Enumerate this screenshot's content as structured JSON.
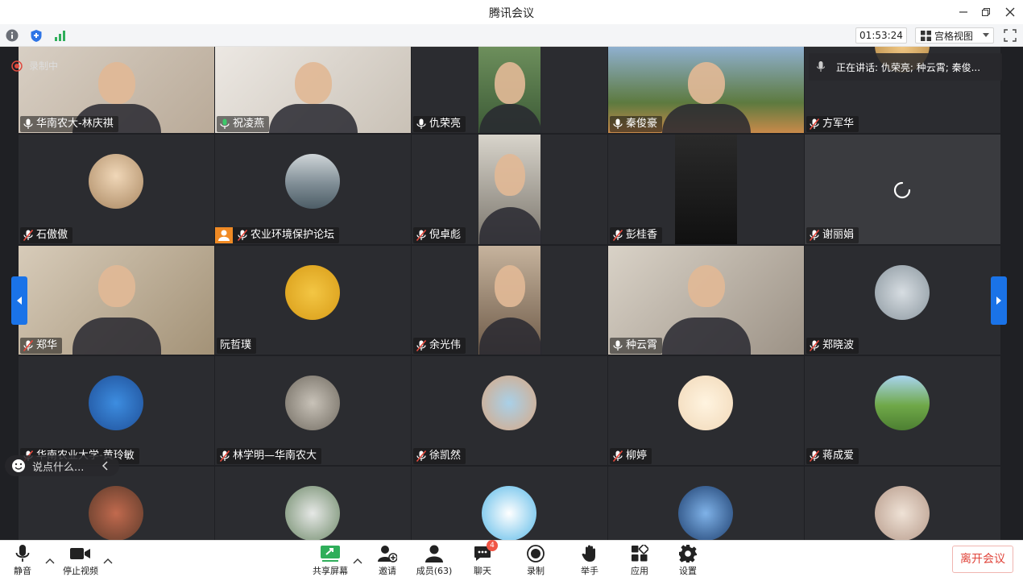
{
  "window": {
    "title": "腾讯会议"
  },
  "infobar": {
    "timer": "01:53:24",
    "view_mode": "宫格视图"
  },
  "stage": {
    "recording_label": "录制中",
    "speaking_label": "正在讲话: 仇荣亮; 种云霄; 秦俊...",
    "chat_placeholder": "说点什么..."
  },
  "participants": [
    {
      "name": "华南农大-林庆祺",
      "mic": "on"
    },
    {
      "name": "祝凌燕",
      "mic": "speaking"
    },
    {
      "name": "仇荣亮",
      "mic": "on"
    },
    {
      "name": "秦俊豪",
      "mic": "on"
    },
    {
      "name": "方军华",
      "mic": "muted"
    },
    {
      "name": "石傲傲",
      "mic": "muted"
    },
    {
      "name": "农业环境保护论坛",
      "mic": "muted"
    },
    {
      "name": "倪卓彪",
      "mic": "muted"
    },
    {
      "name": "彭桂香",
      "mic": "muted"
    },
    {
      "name": "谢丽娟",
      "mic": "muted"
    },
    {
      "name": "郑华",
      "mic": "muted"
    },
    {
      "name": "阮哲璞",
      "mic": "none"
    },
    {
      "name": "余光伟",
      "mic": "muted"
    },
    {
      "name": "种云霄",
      "mic": "on"
    },
    {
      "name": "郑晓波",
      "mic": "muted"
    },
    {
      "name": "华南农业大学-黄玲敏",
      "mic": "muted"
    },
    {
      "name": "林学明—华南农大",
      "mic": "muted"
    },
    {
      "name": "徐凯然",
      "mic": "muted"
    },
    {
      "name": "柳婷",
      "mic": "muted"
    },
    {
      "name": "蒋成爱",
      "mic": "muted"
    },
    {
      "name": "",
      "mic": "none"
    },
    {
      "name": "",
      "mic": "none"
    },
    {
      "name": "",
      "mic": "none"
    },
    {
      "name": "",
      "mic": "none"
    },
    {
      "name": "",
      "mic": "none"
    }
  ],
  "toolbar": {
    "mute": "静音",
    "stop_video": "停止视频",
    "share_screen": "共享屏幕",
    "invite": "邀请",
    "members": "成员(63)",
    "chat": "聊天",
    "chat_badge": "4",
    "record": "录制",
    "raise_hand": "举手",
    "apps": "应用",
    "settings": "设置",
    "leave": "离开会议"
  },
  "colors": {
    "accent": "#1a73e8",
    "danger": "#e0443a",
    "speaking": "#2fae5a",
    "stage_bg": "#1f2024",
    "tile_bg": "#2b2c30"
  }
}
